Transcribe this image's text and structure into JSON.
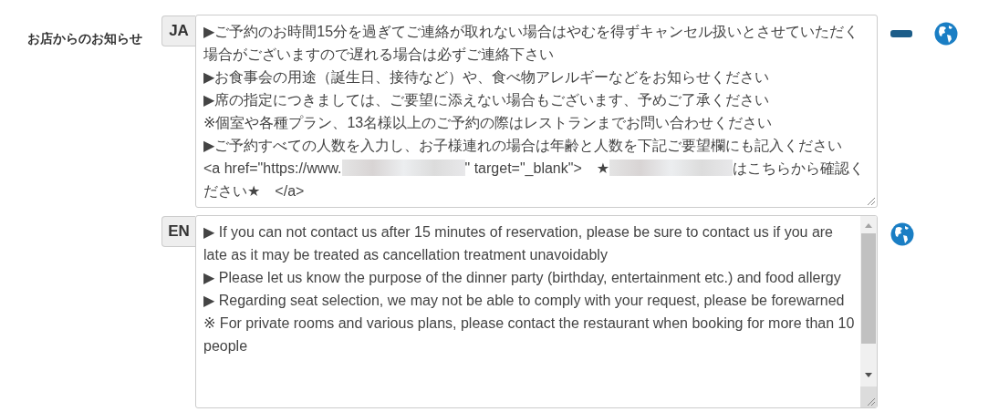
{
  "field_label": "お店からのお知らせ",
  "languages": [
    {
      "code": "JA",
      "scrollable": false,
      "actions": [
        {
          "kind": "remove"
        },
        {
          "kind": "translate"
        }
      ],
      "paragraphs": [
        [
          {
            "kind": "text",
            "text": "▶ご予約のお時間15分を過ぎてご連絡が取れない場合はやむを得ずキャンセル扱いとさせていただく場合がございますので遅れる場合は必ずご連絡下さい"
          }
        ],
        [
          {
            "kind": "text",
            "text": "▶お食事会の用途（誕生日、接待など）や、食べ物アレルギーなどをお知らせください"
          }
        ],
        [
          {
            "kind": "text",
            "text": "▶席の指定につきましては、ご要望に添えない場合もございます、予めご了承ください"
          }
        ],
        [
          {
            "kind": "text",
            "text": "※個室や各種プラン、13名様以上のご予約の際はレストランまでお問い合わせください"
          }
        ],
        [
          {
            "kind": "text",
            "text": "▶ご予約すべての人数を入力し、お子様連れの場合は年齢と人数を下記ご要望欄にも記入ください"
          }
        ],
        [
          {
            "kind": "text",
            "text": "<a href=\"https://www."
          },
          {
            "kind": "redacted"
          },
          {
            "kind": "text",
            "text": "\" target=\"_blank\">　★"
          },
          {
            "kind": "redacted"
          },
          {
            "kind": "text",
            "text": "はこちらから確認ください★　</a>"
          }
        ]
      ]
    },
    {
      "code": "EN",
      "scrollable": true,
      "actions": [
        {
          "kind": "translate"
        }
      ],
      "paragraphs": [
        [
          {
            "kind": "text",
            "text": "▶ If you can not contact us after 15 minutes of reservation, please be sure to contact us if you are late as it may be treated as cancellation treatment unavoidably"
          }
        ],
        [
          {
            "kind": "text",
            "text": "▶ Please let us know the purpose of the dinner party (birthday, entertainment etc.) and food allergy"
          }
        ],
        [
          {
            "kind": "text",
            "text": "▶ Regarding seat selection, we may not be able to comply with your request, please be forewarned"
          }
        ],
        [
          {
            "kind": "text",
            "text": "※ For private rooms and various plans, please contact the restaurant when booking for more than 10 people"
          }
        ]
      ]
    }
  ]
}
